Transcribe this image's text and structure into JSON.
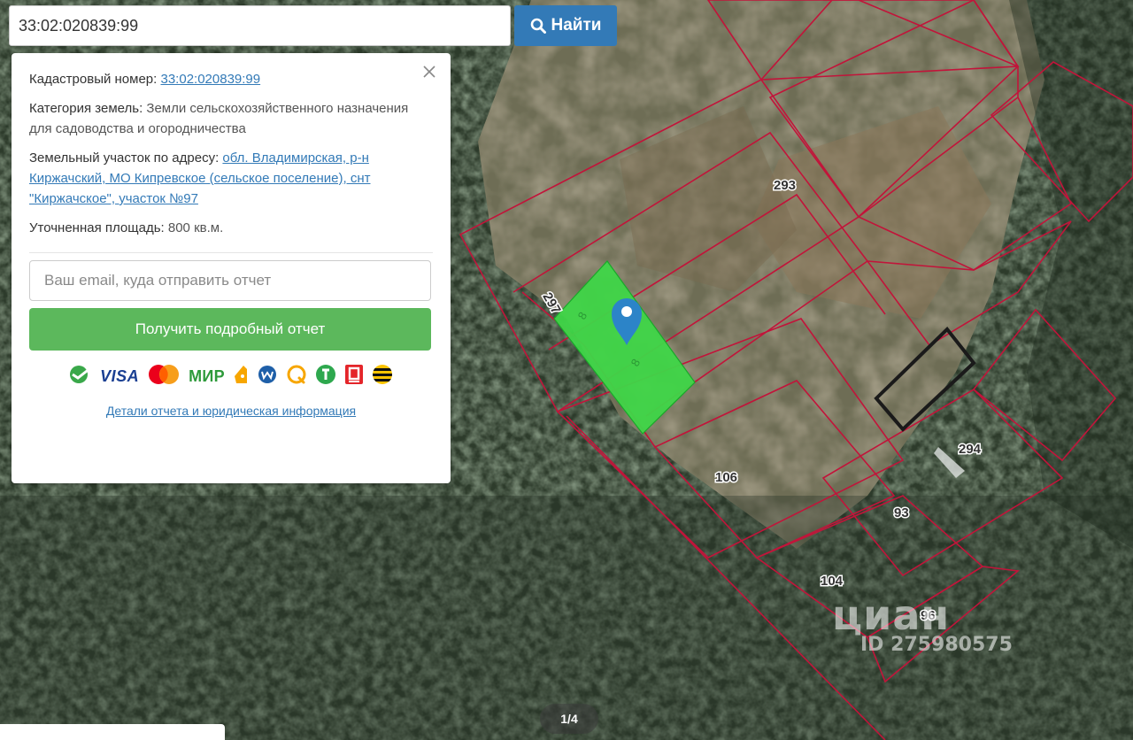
{
  "search": {
    "value": "33:02:020839:99",
    "button_label": "Найти"
  },
  "panel": {
    "cadastral_label": "Кадастровый номер:",
    "cadastral_value": "33:02:020839:99",
    "category_label": "Категория земель:",
    "category_value": "Земли сельскохозяйственного назначения",
    "category_use": "для садоводства и огородничества",
    "address_label": "Земельный участок по адресу:",
    "address_value": "обл. Владимирская, р-н Киржачский, МО Кипревское (сельское поселение), снт \"Киржачское\", участок №97",
    "area_label": "Уточненная площадь:",
    "area_value": "800 кв.м.",
    "email_placeholder": "Ваш email, куда отправить отчет",
    "report_button": "Получить подробный отчет",
    "payment_methods": [
      "sberbank-icon",
      "VISA",
      "mastercard-icon",
      "МИР",
      "yandex-money-icon",
      "webmoney-icon",
      "qiwi-icon",
      "tinkoff-icon",
      "alfa-bank-icon",
      "beeline-icon"
    ],
    "details_link": "Детали отчета и юридическая информация"
  },
  "map": {
    "parcel_labels": [
      "293",
      "297",
      "106",
      "294",
      "93",
      "104",
      "96"
    ],
    "selected_parcel_color": "#3fd648",
    "boundary_color": "#c2143a"
  },
  "pager": "1/4",
  "watermark": {
    "brand": "циан",
    "id": "ID 275980575"
  },
  "colors": {
    "primary": "#337ab7",
    "success": "#5cb85c"
  }
}
